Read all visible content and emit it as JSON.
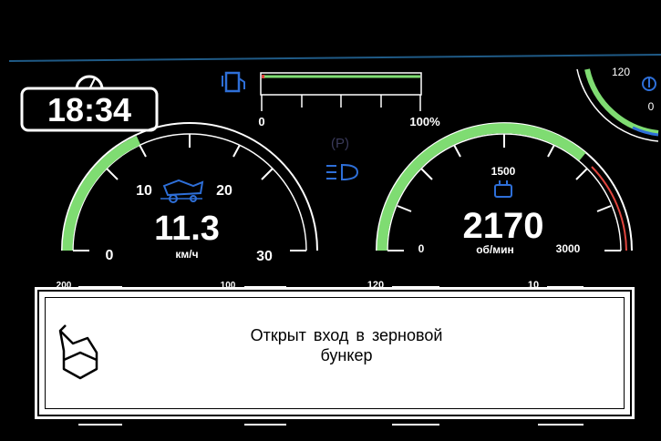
{
  "clock": {
    "time": "18:34",
    "icon": "clock-icon"
  },
  "fuel": {
    "icon": "fuel-pump-icon",
    "scale_min": "0",
    "scale_max": "100%",
    "level": 0.02
  },
  "indicators": {
    "parking_brake": "(P)",
    "headlight_icon": "low-beam-headlight-icon"
  },
  "speed_gauge": {
    "icon": "combine-harvester-icon",
    "ticks": [
      "0",
      "10",
      "20",
      "30"
    ],
    "value": "11.3",
    "unit": "км/ч"
  },
  "rpm_gauge": {
    "icon": "engine-icon",
    "ticks": [
      "0",
      "1500",
      "3000"
    ],
    "value": "2170",
    "unit": "об/мин"
  },
  "temp_gauge": {
    "tick": "120",
    "tick_min": "0",
    "icon": "coolant-temperature-icon"
  },
  "bottom_scales": {
    "labels": [
      "200",
      "100",
      "120",
      "10"
    ]
  },
  "message": {
    "icon": "grain-bunker-icon",
    "line1": "Открыт вход в зерновой",
    "line2": "бункер"
  },
  "colors": {
    "green": "#7fdc72",
    "red": "#e0453e",
    "blue": "#2e6fd8",
    "frame": "#1f5a86"
  }
}
